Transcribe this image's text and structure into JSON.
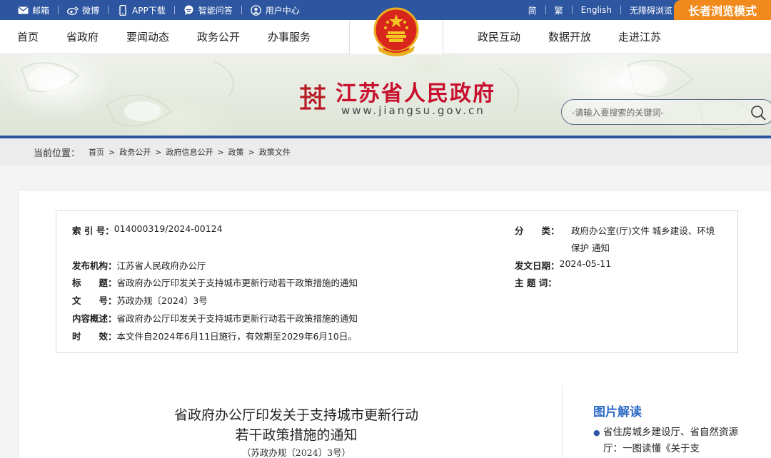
{
  "topbar": {
    "links": [
      {
        "label": "邮箱",
        "icon": "mail-icon"
      },
      {
        "label": "微博",
        "icon": "weibo-icon"
      },
      {
        "label": "APP下载",
        "icon": "mobile-icon"
      },
      {
        "label": "智能问答",
        "icon": "chat-icon"
      },
      {
        "label": "用户中心",
        "icon": "user-icon"
      }
    ],
    "lang_simplified": "简",
    "lang_traditional": "繁",
    "lang_english": "English",
    "accessible": "无障碍浏览",
    "elder_mode": "长者浏览模式"
  },
  "nav": {
    "left": [
      "首页",
      "省政府",
      "要闻动态",
      "政务公开",
      "办事服务"
    ],
    "right": [
      "政民互动",
      "数据开放",
      "走进江苏"
    ]
  },
  "banner": {
    "site_name": "江苏省人民政府",
    "site_url": "www.jiangsu.gov.cn",
    "search_placeholder": "-请输入要搜索的关键词-"
  },
  "breadcrumb": {
    "label": "当前位置：",
    "items": [
      "首页",
      "政务公开",
      "政府信息公开",
      "政策",
      "政策文件"
    ],
    "separator": ">"
  },
  "meta": {
    "index_key": "索 引 号：",
    "index_val": "014000319/2024-00124",
    "category_key": "分　　类：",
    "category_val_1": "政府办公室(厅)文件 城乡建设、环境",
    "category_val_2": "保护 通知",
    "issuer_key": "发布机构：",
    "issuer_val": "江苏省人民政府办公厅",
    "date_key": "发文日期：",
    "date_val": "2024-05-11",
    "title_key": "标　　题：",
    "title_val": "省政府办公厅印发关于支持城市更新行动若干政策措施的通知",
    "subject_key": "主 题 词：",
    "subject_val": "",
    "docno_key": "文　　号：",
    "docno_val": "苏政办规〔2024〕3号",
    "summary_key": "内容概述：",
    "summary_val": "省政府办公厅印发关于支持城市更新行动若干政策措施的通知",
    "validity_key": "时　　效：",
    "validity_val": "本文件自2024年6月11日施行，有效期至2029年6月10日。"
  },
  "document": {
    "title_line1": "省政府办公厅印发关于支持城市更新行动",
    "title_line2": "若干政策措施的通知",
    "doc_number": "（苏政办规〔2024〕3号）"
  },
  "sidebar": {
    "title": "图片解读",
    "item_1": "省住房城乡建设厅、省自然资源厅：一图读懂《关于支"
  },
  "colors": {
    "primary_blue": "#2d55a0",
    "elder_orange": "#f08a1c",
    "brand_red": "#c8102e",
    "sidebar_title_blue": "#2d6cc7"
  }
}
